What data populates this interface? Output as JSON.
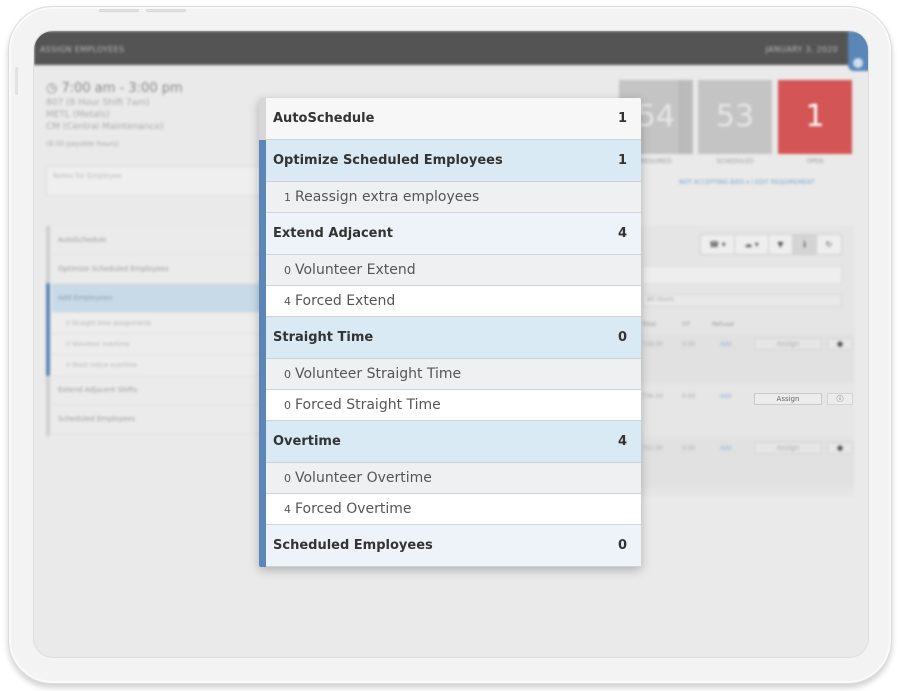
{
  "app": {
    "page_title": "ASSIGN EMPLOYEES",
    "date": "JANUARY 3, 2020"
  },
  "shift": {
    "time": "7:00 am - 3:00 pm",
    "lines": [
      "807 (8 Hour Shift 7am)",
      "METL (Metals)",
      "CM (Central Maintenance)"
    ],
    "payable": "(8.00 payable hours)",
    "notes_placeholder": "Notes for Employee"
  },
  "stats": [
    {
      "label": "REQUIRED",
      "value": "54",
      "color": "#c4c4c4"
    },
    {
      "label": "SCHEDULED",
      "value": "53",
      "color": "#c4c4c4"
    },
    {
      "label": "OPEN",
      "value": "1",
      "color": "#d45556"
    }
  ],
  "links": {
    "not_accepting_bids": "NOT ACCEPTING BIDS",
    "edit_requirement": "EDIT REQUIREMENT"
  },
  "sidebar": {
    "items": [
      {
        "label": "AutoSchedule"
      },
      {
        "label": "Optimize Scheduled Employees"
      },
      {
        "label": "Add Employees",
        "active": true
      },
      {
        "label": "0 Straight time assignments",
        "sub": true
      },
      {
        "label": "0 Volunteer overtime",
        "sub": true
      },
      {
        "label": "0 Short notice overtime",
        "sub": true
      },
      {
        "label": "Extend Adjacent Shifts"
      },
      {
        "label": "Scheduled Employees"
      }
    ]
  },
  "right_panel": {
    "toolbar": [
      {
        "icon": "phone-icon",
        "glyph": "☎ ▾"
      },
      {
        "icon": "cloud-icon",
        "glyph": "☁ ▾"
      },
      {
        "icon": "filter-icon",
        "glyph": "▼"
      },
      {
        "icon": "info-icon",
        "glyph": "ℹ"
      },
      {
        "icon": "refresh-icon",
        "glyph": "↻"
      }
    ],
    "select_value": "All Hours",
    "columns": [
      "Total",
      "OT",
      "Refusal"
    ],
    "rows": [
      {
        "total": "728.00",
        "ot": "0.00",
        "refusal": "Add",
        "action": "Assign"
      },
      {
        "total": "736.00",
        "ot": "0.00",
        "refusal": "Add",
        "action": "Assign"
      },
      {
        "total": "752.00",
        "ot": "0.00",
        "refusal": "Add",
        "action": "Assign"
      }
    ]
  },
  "popover": {
    "groups": [
      {
        "label": "AutoSchedule",
        "count": "1",
        "style": "white",
        "accent": "grey",
        "items": []
      },
      {
        "label": "Optimize Scheduled Employees",
        "count": "1",
        "style": "blue",
        "accent": "blue",
        "items": [
          {
            "count": "1",
            "label": "Reassign extra employees",
            "style": "grey"
          }
        ]
      },
      {
        "label": "Extend Adjacent",
        "count": "4",
        "style": "light",
        "accent": "blue",
        "items": [
          {
            "count": "0",
            "label": "Volunteer Extend",
            "style": "grey"
          },
          {
            "count": "4",
            "label": "Forced Extend",
            "style": "white"
          }
        ]
      },
      {
        "label": "Straight Time",
        "count": "0",
        "style": "blue",
        "accent": "blue",
        "items": [
          {
            "count": "0",
            "label": "Volunteer Straight Time",
            "style": "grey"
          },
          {
            "count": "0",
            "label": "Forced Straight Time",
            "style": "white"
          }
        ]
      },
      {
        "label": "Overtime",
        "count": "4",
        "style": "blue",
        "accent": "blue",
        "items": [
          {
            "count": "0",
            "label": "Volunteer Overtime",
            "style": "grey"
          },
          {
            "count": "4",
            "label": "Forced Overtime",
            "style": "white"
          }
        ]
      },
      {
        "label": "Scheduled Employees",
        "count": "0",
        "style": "light",
        "accent": "blue",
        "items": []
      }
    ]
  }
}
